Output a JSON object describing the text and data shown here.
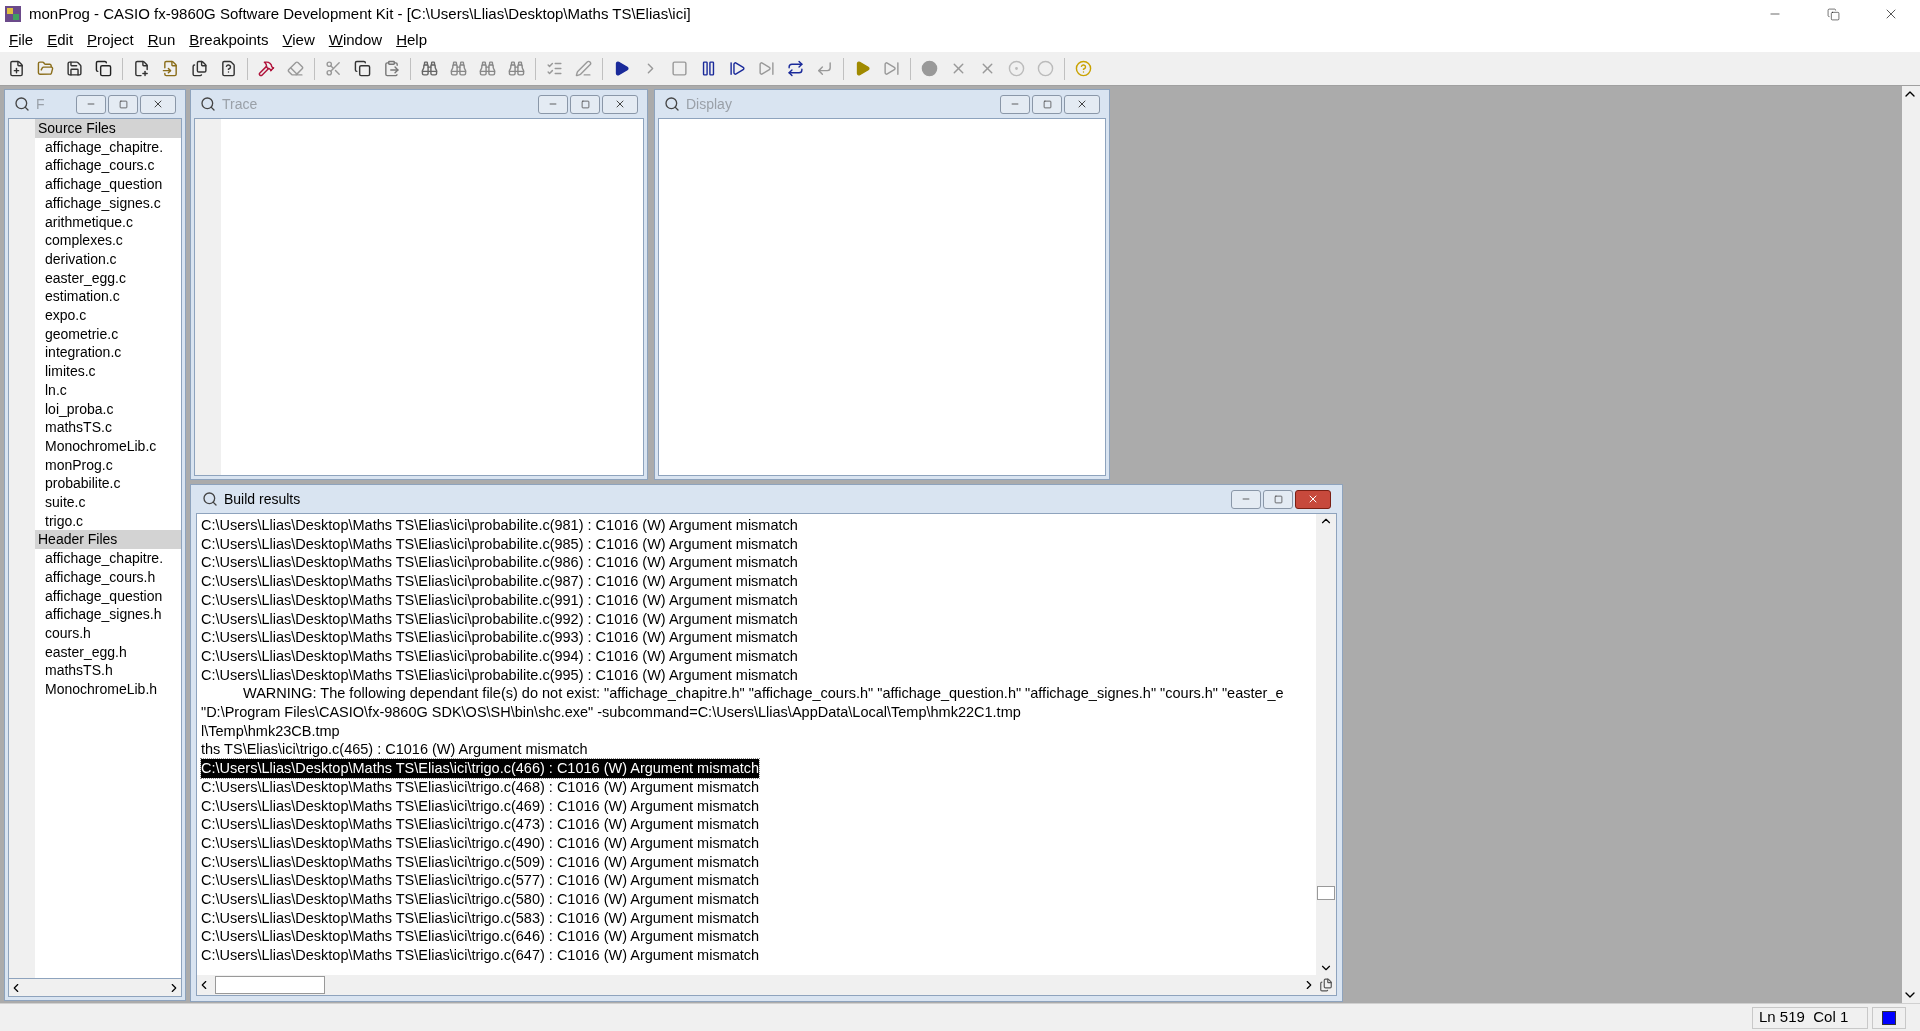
{
  "window": {
    "title": "monProg - CASIO fx-9860G Software Development Kit - [C:\\Users\\Llias\\Desktop\\Maths TS\\Elias\\ici]"
  },
  "menu": [
    "File",
    "Edit",
    "Project",
    "Run",
    "Breakpoints",
    "View",
    "Window",
    "Help"
  ],
  "file_panel": {
    "title": "F",
    "active": false,
    "groups": [
      {
        "label": "Source Files",
        "files": [
          "affichage_chapitre.",
          "affichage_cours.c",
          "affichage_question",
          "affichage_signes.c",
          "arithmetique.c",
          "complexes.c",
          "derivation.c",
          "easter_egg.c",
          "estimation.c",
          "expo.c",
          "geometrie.c",
          "integration.c",
          "limites.c",
          "ln.c",
          "loi_proba.c",
          "mathsTS.c",
          "MonochromeLib.c",
          "monProg.c",
          "probabilite.c",
          "suite.c",
          "trigo.c"
        ]
      },
      {
        "label": "Header Files",
        "files": [
          "affichage_chapitre.",
          "affichage_cours.h",
          "affichage_question",
          "affichage_signes.h",
          "cours.h",
          "easter_egg.h",
          "mathsTS.h",
          "MonochromeLib.h"
        ]
      }
    ]
  },
  "trace": {
    "title": "Trace",
    "active": false
  },
  "display": {
    "title": "Display",
    "active": false
  },
  "build_results": {
    "title": "Build results",
    "active": true,
    "lines": [
      {
        "text": "C:\\Users\\Llias\\Desktop\\Maths TS\\Elias\\ici\\probabilite.c(981) : C1016 (W) Argument mismatch",
        "kind": "plain",
        "selected": false
      },
      {
        "text": "C:\\Users\\Llias\\Desktop\\Maths TS\\Elias\\ici\\probabilite.c(985) : C1016 (W) Argument mismatch",
        "kind": "plain",
        "selected": false
      },
      {
        "text": "C:\\Users\\Llias\\Desktop\\Maths TS\\Elias\\ici\\probabilite.c(986) : C1016 (W) Argument mismatch",
        "kind": "plain",
        "selected": false
      },
      {
        "text": "C:\\Users\\Llias\\Desktop\\Maths TS\\Elias\\ici\\probabilite.c(987) : C1016 (W) Argument mismatch",
        "kind": "plain",
        "selected": false
      },
      {
        "text": "C:\\Users\\Llias\\Desktop\\Maths TS\\Elias\\ici\\probabilite.c(991) : C1016 (W) Argument mismatch",
        "kind": "plain",
        "selected": false
      },
      {
        "text": "C:\\Users\\Llias\\Desktop\\Maths TS\\Elias\\ici\\probabilite.c(992) : C1016 (W) Argument mismatch",
        "kind": "plain",
        "selected": false
      },
      {
        "text": "C:\\Users\\Llias\\Desktop\\Maths TS\\Elias\\ici\\probabilite.c(993) : C1016 (W) Argument mismatch",
        "kind": "plain",
        "selected": false
      },
      {
        "text": "C:\\Users\\Llias\\Desktop\\Maths TS\\Elias\\ici\\probabilite.c(994) : C1016 (W) Argument mismatch",
        "kind": "plain",
        "selected": false
      },
      {
        "text": "C:\\Users\\Llias\\Desktop\\Maths TS\\Elias\\ici\\probabilite.c(995) : C1016 (W) Argument mismatch",
        "kind": "plain",
        "selected": false
      },
      {
        "text": "WARNING: The following dependant file(s) do not exist: \"affichage_chapitre.h\" \"affichage_cours.h\" \"affichage_question.h\" \"affichage_signes.h\" \"cours.h\" \"easter_e",
        "kind": "indented",
        "selected": false
      },
      {
        "text": "\"D:\\Program Files\\CASIO\\fx-9860G SDK\\OS\\SH\\bin\\shc.exe\" -subcommand=C:\\Users\\Llias\\AppData\\Local\\Temp\\hmk22C1.tmp",
        "kind": "plain",
        "selected": false
      },
      {
        "text": "l\\Temp\\hmk23CB.tmp",
        "kind": "plain",
        "selected": false
      },
      {
        "text": "ths TS\\Elias\\ici\\trigo.c(465) : C1016 (W) Argument mismatch",
        "kind": "plain",
        "selected": false
      },
      {
        "text": "C:\\Users\\Llias\\Desktop\\Maths TS\\Elias\\ici\\trigo.c(466) : C1016 (W) Argument mismatch",
        "kind": "plain",
        "selected": true
      },
      {
        "text": "C:\\Users\\Llias\\Desktop\\Maths TS\\Elias\\ici\\trigo.c(468) : C1016 (W) Argument mismatch",
        "kind": "plain",
        "selected": false
      },
      {
        "text": "C:\\Users\\Llias\\Desktop\\Maths TS\\Elias\\ici\\trigo.c(469) : C1016 (W) Argument mismatch",
        "kind": "plain",
        "selected": false
      },
      {
        "text": "C:\\Users\\Llias\\Desktop\\Maths TS\\Elias\\ici\\trigo.c(473) : C1016 (W) Argument mismatch",
        "kind": "plain",
        "selected": false
      },
      {
        "text": "C:\\Users\\Llias\\Desktop\\Maths TS\\Elias\\ici\\trigo.c(490) : C1016 (W) Argument mismatch",
        "kind": "plain",
        "selected": false
      },
      {
        "text": "C:\\Users\\Llias\\Desktop\\Maths TS\\Elias\\ici\\trigo.c(509) : C1016 (W) Argument mismatch",
        "kind": "plain",
        "selected": false
      },
      {
        "text": "C:\\Users\\Llias\\Desktop\\Maths TS\\Elias\\ici\\trigo.c(577) : C1016 (W) Argument mismatch",
        "kind": "plain",
        "selected": false
      },
      {
        "text": "C:\\Users\\Llias\\Desktop\\Maths TS\\Elias\\ici\\trigo.c(580) : C1016 (W) Argument mismatch",
        "kind": "plain",
        "selected": false
      },
      {
        "text": "C:\\Users\\Llias\\Desktop\\Maths TS\\Elias\\ici\\trigo.c(583) : C1016 (W) Argument mismatch",
        "kind": "plain",
        "selected": false
      },
      {
        "text": "C:\\Users\\Llias\\Desktop\\Maths TS\\Elias\\ici\\trigo.c(646) : C1016 (W) Argument mismatch",
        "kind": "plain",
        "selected": false
      },
      {
        "text": "C:\\Users\\Llias\\Desktop\\Maths TS\\Elias\\ici\\trigo.c(647) : C1016 (W) Argument mismatch",
        "kind": "plain",
        "selected": false
      }
    ]
  },
  "status_bar": {
    "position": "Ln 519  Col 1"
  }
}
